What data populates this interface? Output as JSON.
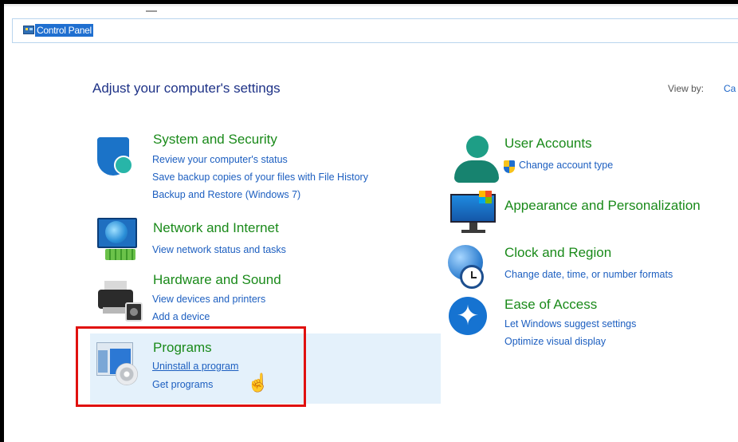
{
  "address_bar": {
    "title": "Control Panel"
  },
  "main": {
    "heading": "Adjust your computer's settings",
    "view_by_label": "View by:",
    "view_by_value": "Ca"
  },
  "left_categories": [
    {
      "title": "System and Security",
      "links": [
        "Review your computer's status",
        "Save backup copies of your files with File History",
        "Backup and Restore (Windows 7)"
      ]
    },
    {
      "title": "Network and Internet",
      "links": [
        "View network status and tasks"
      ]
    },
    {
      "title": "Hardware and Sound",
      "links": [
        "View devices and printers",
        "Add a device"
      ]
    },
    {
      "title": "Programs",
      "links": [
        "Uninstall a program",
        "Get programs"
      ]
    }
  ],
  "right_categories": [
    {
      "title": "User Accounts",
      "links": [
        "Change account type"
      ]
    },
    {
      "title": "Appearance and Personalization",
      "links": []
    },
    {
      "title": "Clock and Region",
      "links": [
        "Change date, time, or number formats"
      ]
    },
    {
      "title": "Ease of Access",
      "links": [
        "Let Windows suggest settings",
        "Optimize visual display"
      ]
    }
  ],
  "icons": {
    "address": "control-panel-icon",
    "system": "shield-icon",
    "network": "network-globe-icon",
    "hardware": "printer-icon",
    "programs": "programs-disc-icon",
    "users": "user-icon",
    "appearance": "monitor-icon",
    "clock": "clock-globe-icon",
    "ease": "accessibility-icon",
    "uac": "uac-shield-icon",
    "cursor": "hand-cursor-icon"
  },
  "colors": {
    "category_title": "#1a8a1a",
    "link": "#1d5fc0",
    "heading": "#1e3287",
    "highlight": "#e4f1fb",
    "annotation": "#e0110f"
  }
}
